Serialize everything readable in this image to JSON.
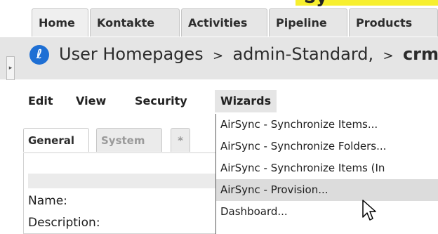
{
  "top_strip": {
    "text": "...",
    "highlight": "Sy"
  },
  "tabs": [
    {
      "label": "Home"
    },
    {
      "label": "Kontakte"
    },
    {
      "label": "Activities"
    },
    {
      "label": "Pipeline"
    },
    {
      "label": "Products"
    }
  ],
  "header": {
    "icon": "sugar-logo-icon",
    "breadcrumb_parts": [
      "User Homepages",
      "admin-Standard,",
      "crm"
    ]
  },
  "menubar": {
    "items": [
      {
        "label": "Edit"
      },
      {
        "label": "View"
      },
      {
        "label": "Security"
      },
      {
        "label": "Wizards"
      }
    ],
    "active": "Wizards"
  },
  "wizards_menu": {
    "items": [
      {
        "label": "AirSync - Synchronize Items..."
      },
      {
        "label": "AirSync - Synchronize Folders..."
      },
      {
        "label": "AirSync - Synchronize Items (In"
      },
      {
        "label": "AirSync - Provision..."
      },
      {
        "label": "Dashboard..."
      }
    ],
    "hovered_index": 3
  },
  "panel": {
    "tabs": [
      {
        "label": "General"
      },
      {
        "label": "System"
      },
      {
        "label": "*"
      }
    ],
    "fields": [
      {
        "label": "Name:"
      },
      {
        "label": "Description:"
      }
    ]
  },
  "colors": {
    "highlight": "#f7ef2e",
    "header_band": "#e5e5e5",
    "logo": "#1e6fd4",
    "hover": "#dcdcdc"
  }
}
